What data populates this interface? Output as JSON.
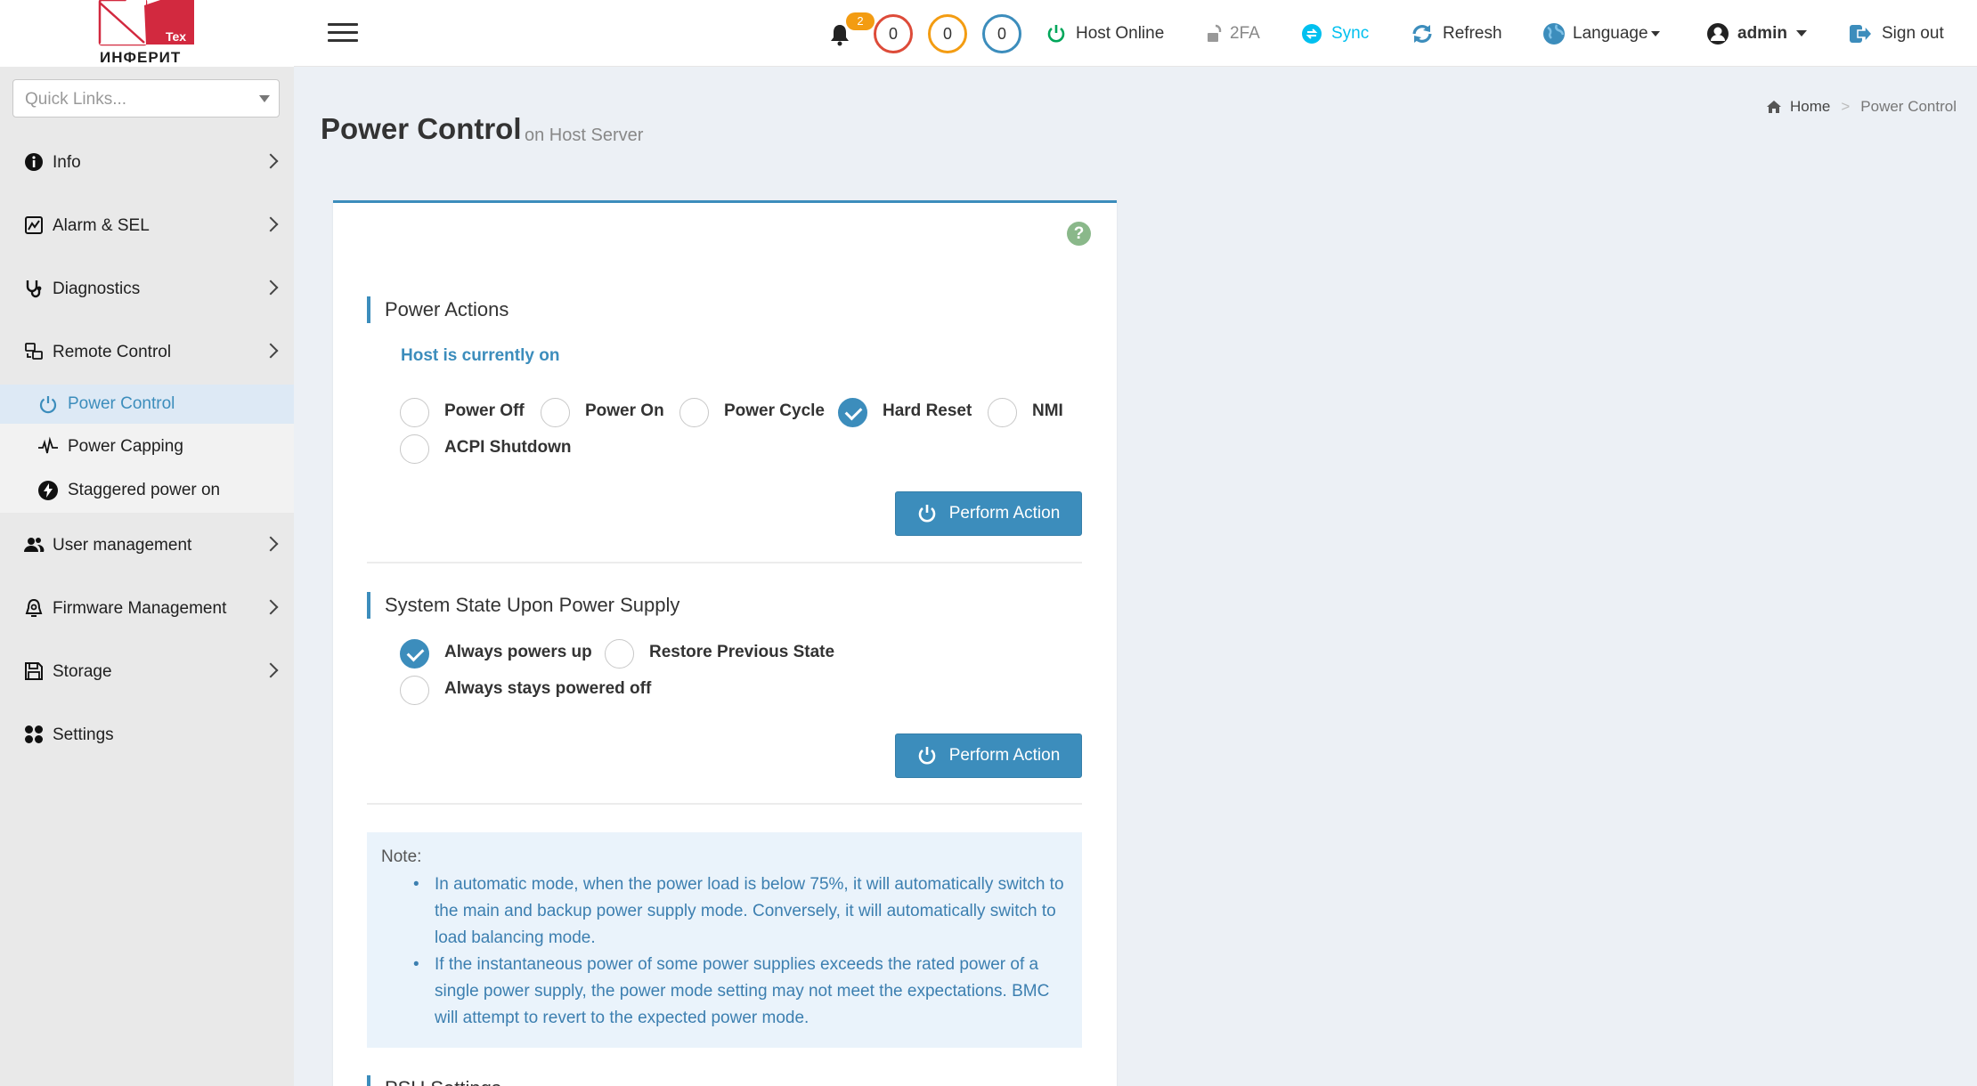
{
  "logo": {
    "brand": "ИНФЕРИТ",
    "sub": "Tex"
  },
  "quick_links": {
    "placeholder": "Quick Links..."
  },
  "sidebar": {
    "items": [
      {
        "label": "Info"
      },
      {
        "label": "Alarm & SEL"
      },
      {
        "label": "Diagnostics"
      },
      {
        "label": "Remote Control"
      },
      {
        "label": "User management"
      },
      {
        "label": "Firmware Management"
      },
      {
        "label": "Storage"
      },
      {
        "label": "Settings"
      }
    ],
    "submenu": [
      {
        "label": "Power Control",
        "active": true
      },
      {
        "label": "Power Capping"
      },
      {
        "label": "Staggered power on"
      }
    ]
  },
  "header": {
    "notifications": "2",
    "counters": [
      {
        "value": "0",
        "color": "#dd4b39"
      },
      {
        "value": "0",
        "color": "#f39c12"
      },
      {
        "value": "0",
        "color": "#3c8dbc"
      }
    ],
    "host_status": "Host Online",
    "twofa": "2FA",
    "sync": "Sync",
    "refresh": "Refresh",
    "language": "Language",
    "user": "admin",
    "signout": "Sign out"
  },
  "page": {
    "title": "Power Control",
    "subtitle": "on Host Server",
    "breadcrumb_home": "Home",
    "breadcrumb_sep": ">",
    "breadcrumb_current": "Power Control"
  },
  "power_actions": {
    "title": "Power Actions",
    "status": "Host is currently on",
    "options": [
      {
        "label": "Power Off",
        "checked": false
      },
      {
        "label": "Power On",
        "checked": false
      },
      {
        "label": "Power Cycle",
        "checked": false
      },
      {
        "label": "Hard Reset",
        "checked": true
      },
      {
        "label": "NMI",
        "checked": false
      },
      {
        "label": "ACPI Shutdown",
        "checked": false
      }
    ],
    "button": "Perform Action"
  },
  "system_state": {
    "title": "System State Upon Power Supply",
    "options": [
      {
        "label": "Always powers up",
        "checked": true
      },
      {
        "label": "Restore Previous State",
        "checked": false
      },
      {
        "label": "Always stays powered off",
        "checked": false
      }
    ],
    "button": "Perform Action"
  },
  "note": {
    "title": "Note:",
    "items": [
      "In automatic mode, when the power load is below 75%, it will automatically switch to the main and backup power supply mode. Conversely, it will automatically switch to load balancing mode.",
      "If the instantaneous power of some power supplies exceeds the rated power of a single power supply, the power mode setting may not meet the expectations. BMC will attempt to revert to the expected power mode."
    ]
  },
  "psu_title": "PSU Settings",
  "colors": {
    "accent": "#3c8dbc",
    "online": "#00a65a",
    "sync": "#00c0ef"
  }
}
